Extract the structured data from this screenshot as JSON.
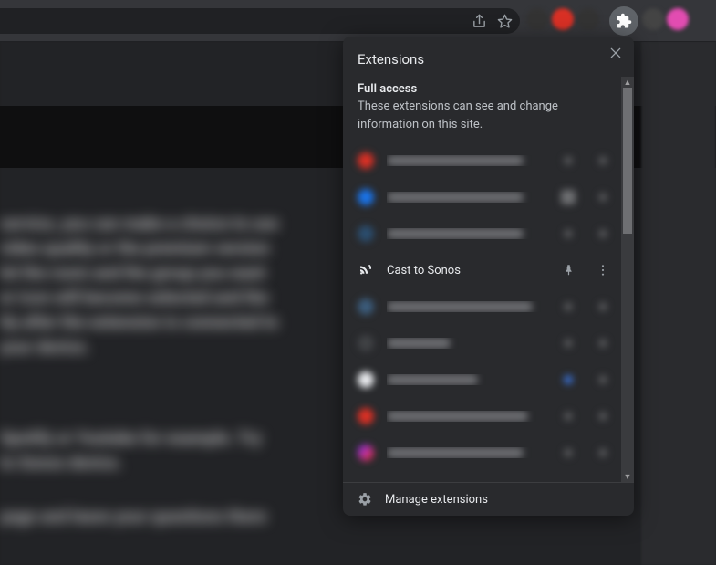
{
  "popup": {
    "title": "Extensions",
    "section_heading": "Full access",
    "section_desc": "These extensions can see and change information on this site.",
    "manage_label": "Manage extensions",
    "items": [
      {
        "name": "",
        "color": "#d93025",
        "blurred": true
      },
      {
        "name": "",
        "color": "#1a73e8",
        "blurred": true
      },
      {
        "name": "",
        "color": "#2b4d6e",
        "blurred": true
      },
      {
        "name": "Cast to Sonos",
        "color": "",
        "blurred": false
      },
      {
        "name": "",
        "color": "#3b5b7a",
        "blurred": true
      },
      {
        "name": "",
        "color": "#404245",
        "blurred": true
      },
      {
        "name": "",
        "color": "#e8eaed",
        "blurred": true
      },
      {
        "name": "",
        "color": "#d93025",
        "blurred": true
      },
      {
        "name": "",
        "color": "#7b2ff7",
        "blurred": true
      }
    ]
  },
  "icons": {
    "share": "share-icon",
    "star": "star-icon",
    "puzzle": "puzzle-icon",
    "close": "close-icon",
    "pin": "pin-icon",
    "more": "more-icon",
    "gear": "gear-icon",
    "sonos": "sonos-icon"
  },
  "colors": {
    "popup_bg": "#292a2d",
    "text_primary": "#e8eaed",
    "text_secondary": "#9aa0a6"
  }
}
